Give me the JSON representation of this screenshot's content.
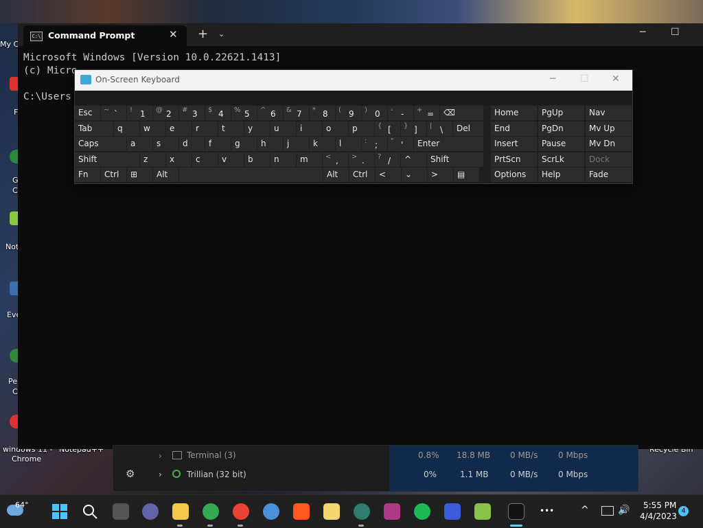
{
  "desktop": {
    "left_labels": [
      "My C",
      "F",
      "G",
      "C",
      "Not",
      "Eve",
      "Pe",
      "C"
    ],
    "bottom_labels": [
      "windows 11 -",
      "Chrome",
      "Notepad++",
      "Recycle Bin"
    ]
  },
  "terminal": {
    "tab_title": "Command Prompt",
    "tab_close": "✕",
    "new_tab": "+",
    "tab_dropdown": "⌄",
    "minimize": "─",
    "maximize": "☐",
    "close": "✕",
    "lines": [
      "Microsoft Windows [Version 10.0.22621.1413]",
      "(c) Micro",
      "",
      "C:\\Users"
    ]
  },
  "osk": {
    "title": "On-Screen Keyboard",
    "minimize": "─",
    "maximize": "☐",
    "close": "✕",
    "rows": [
      [
        {
          "p": "Esc",
          "w": 38
        },
        {
          "s": "~",
          "p": "`",
          "w": 38
        },
        {
          "s": "!",
          "p": "1",
          "w": 38
        },
        {
          "s": "@",
          "p": "2",
          "w": 38
        },
        {
          "s": "#",
          "p": "3",
          "w": 38
        },
        {
          "s": "$",
          "p": "4",
          "w": 38
        },
        {
          "s": "%",
          "p": "5",
          "w": 38
        },
        {
          "s": "^",
          "p": "6",
          "w": 38
        },
        {
          "s": "&",
          "p": "7",
          "w": 38
        },
        {
          "s": "*",
          "p": "8",
          "w": 38
        },
        {
          "s": "(",
          "p": "9",
          "w": 38
        },
        {
          "s": ")",
          "p": "0",
          "w": 38
        },
        {
          "s": "-",
          "p": "-",
          "w": 38
        },
        {
          "s": "+",
          "p": "=",
          "w": 38
        },
        {
          "p": "⌫",
          "w": 64
        }
      ],
      [
        {
          "p": "Tab",
          "w": 57
        },
        {
          "p": "q",
          "w": 38
        },
        {
          "p": "w",
          "w": 38
        },
        {
          "p": "e",
          "w": 38
        },
        {
          "p": "r",
          "w": 38
        },
        {
          "p": "t",
          "w": 38
        },
        {
          "p": "y",
          "w": 38
        },
        {
          "p": "u",
          "w": 38
        },
        {
          "p": "i",
          "w": 38
        },
        {
          "p": "o",
          "w": 38
        },
        {
          "p": "p",
          "w": 38
        },
        {
          "s": "{",
          "p": "[",
          "w": 38
        },
        {
          "s": "}",
          "p": "]",
          "w": 38
        },
        {
          "s": "|",
          "p": "\\",
          "w": 38
        },
        {
          "p": "Del",
          "w": 45
        }
      ],
      [
        {
          "p": "Caps",
          "w": 76
        },
        {
          "p": "a",
          "w": 38
        },
        {
          "p": "s",
          "w": 38
        },
        {
          "p": "d",
          "w": 38
        },
        {
          "p": "f",
          "w": 38
        },
        {
          "p": "g",
          "w": 38
        },
        {
          "p": "h",
          "w": 38
        },
        {
          "p": "j",
          "w": 38
        },
        {
          "p": "k",
          "w": 38
        },
        {
          "p": "l",
          "w": 38
        },
        {
          "s": ":",
          "p": ";",
          "w": 38
        },
        {
          "s": "\"",
          "p": "'",
          "w": 38
        },
        {
          "p": "Enter",
          "w": 102
        }
      ],
      [
        {
          "p": "Shift",
          "w": 95
        },
        {
          "p": "z",
          "w": 38
        },
        {
          "p": "x",
          "w": 38
        },
        {
          "p": "c",
          "w": 38
        },
        {
          "p": "v",
          "w": 38
        },
        {
          "p": "b",
          "w": 38
        },
        {
          "p": "n",
          "w": 38
        },
        {
          "p": "m",
          "w": 38
        },
        {
          "s": "<",
          "p": ",",
          "w": 38
        },
        {
          "s": ">",
          "p": ".",
          "w": 38
        },
        {
          "s": "?",
          "p": "/",
          "w": 38
        },
        {
          "p": "^",
          "w": 38
        },
        {
          "p": "Shift",
          "w": 83
        }
      ],
      [
        {
          "p": "Fn",
          "w": 38
        },
        {
          "p": "Ctrl",
          "w": 38
        },
        {
          "p": "⊞",
          "w": 38
        },
        {
          "p": "Alt",
          "w": 38
        },
        {
          "p": "",
          "w": 210
        },
        {
          "p": "Alt",
          "w": 38
        },
        {
          "p": "Ctrl",
          "w": 38
        },
        {
          "p": "<",
          "w": 38
        },
        {
          "p": "⌄",
          "w": 38
        },
        {
          "p": ">",
          "w": 38
        },
        {
          "p": "▤",
          "w": 38
        }
      ]
    ],
    "nav_rows": [
      [
        "Home",
        "PgUp",
        "Nav"
      ],
      [
        "End",
        "PgDn",
        "Mv Up"
      ],
      [
        "Insert",
        "Pause",
        "Mv Dn"
      ],
      [
        "PrtScn",
        "ScrLk",
        "Dock"
      ],
      [
        "Options",
        "Help",
        "Fade"
      ]
    ]
  },
  "task_manager": {
    "settings_icon": "⚙",
    "rows": [
      {
        "name": "Terminal (3)",
        "cpu": "0.8%",
        "mem": "18.8 MB",
        "disk": "0 MB/s",
        "net": "0 Mbps"
      },
      {
        "name": "Trillian (32 bit)",
        "cpu": "0%",
        "mem": "1.1 MB",
        "disk": "0 MB/s",
        "net": "0 Mbps"
      }
    ]
  },
  "taskbar": {
    "weather_temp": "64°",
    "time": "5:55 PM",
    "date": "4/4/2023",
    "notification_count": "4",
    "more": "•••",
    "tray_chevron": "^"
  },
  "colors": {
    "accent": "#0078d4",
    "terminal_bg": "#0c0c0c",
    "key_bg": "#2b2b2b",
    "osk_title_bg": "#f3f3f3"
  }
}
